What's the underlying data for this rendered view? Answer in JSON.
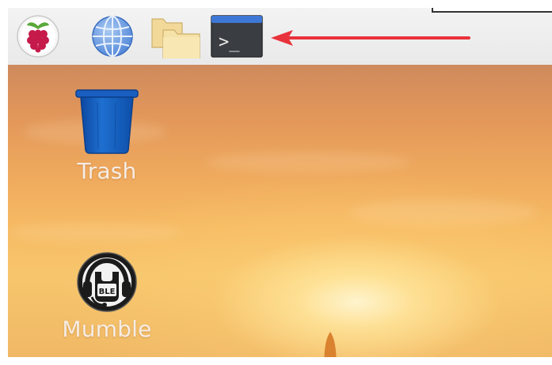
{
  "taskbar": {
    "launchers": [
      {
        "icon": "raspberry-menu-icon"
      },
      {
        "icon": "web-browser-globe-icon"
      },
      {
        "icon": "file-manager-folder-icon"
      },
      {
        "icon": "terminal-icon",
        "text": ">_"
      }
    ],
    "annotation_arrow_color": "#e8323c"
  },
  "desktop": {
    "icons": [
      {
        "label": "Trash",
        "icon": "trash-can-icon",
        "color": "#1565c0"
      },
      {
        "label": "Mumble",
        "icon": "mumble-icon"
      }
    ]
  }
}
